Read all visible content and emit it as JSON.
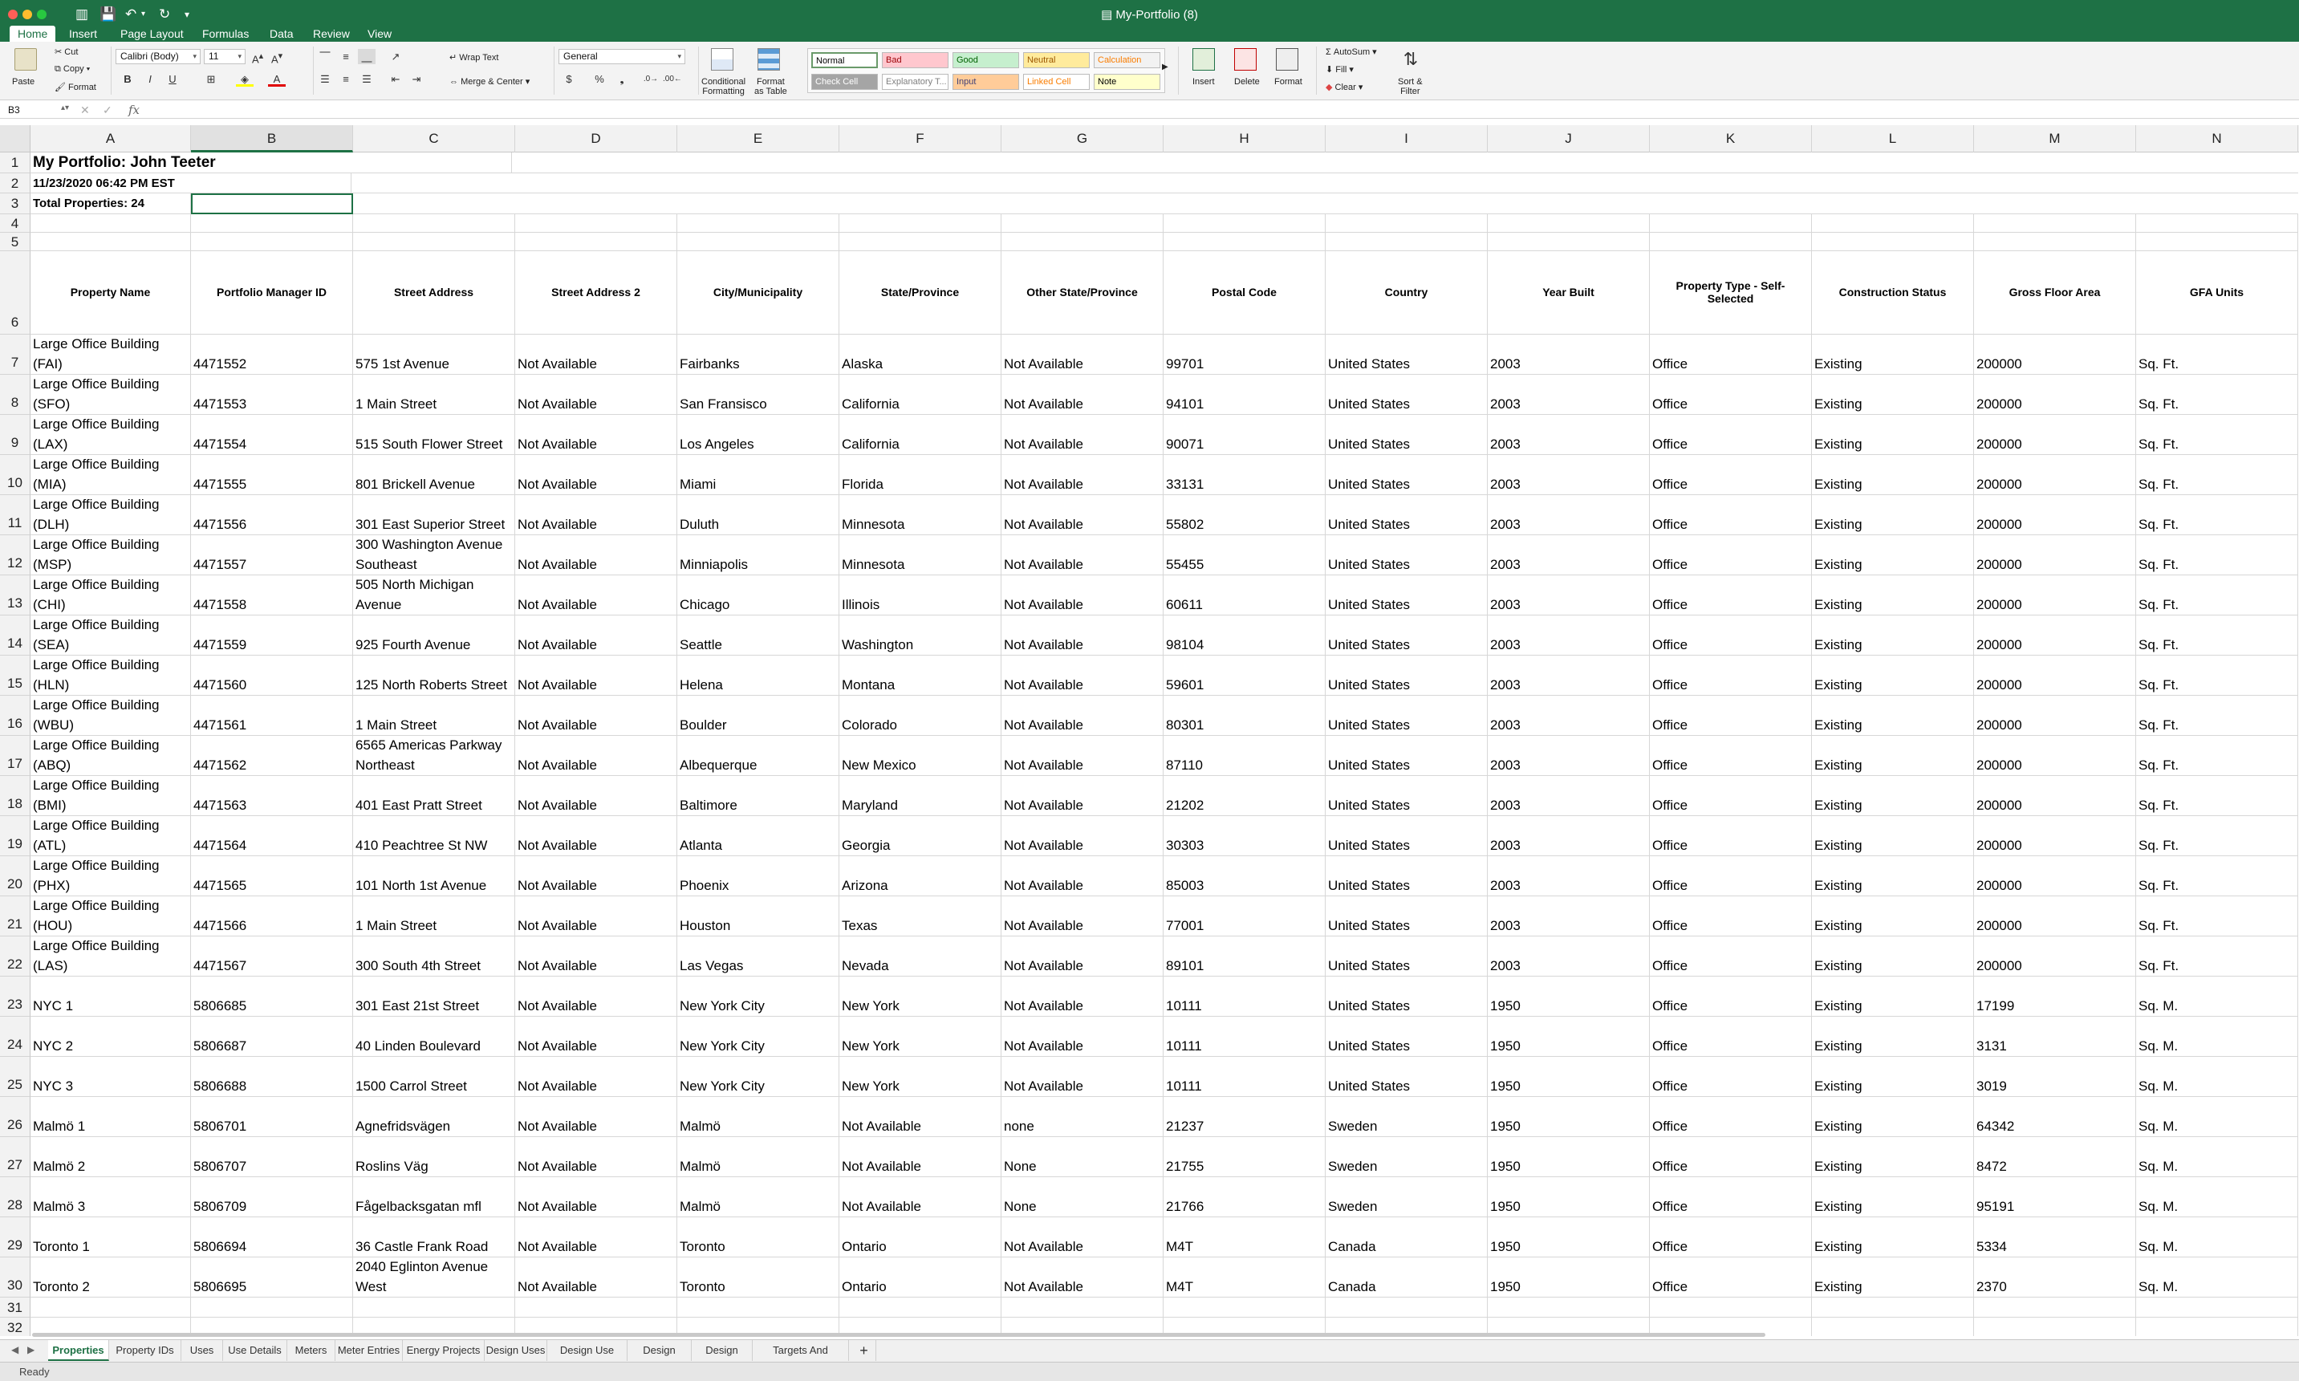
{
  "window": {
    "title": "My-Portfolio (8)"
  },
  "ribbon_tabs": [
    "Home",
    "Insert",
    "Page Layout",
    "Formulas",
    "Data",
    "Review",
    "View"
  ],
  "ribbon": {
    "paste": "Paste",
    "cut": "Cut",
    "copy": "Copy",
    "format_painter": "Format",
    "font_name": "Calibri (Body)",
    "font_size": "11",
    "wrap_text": "Wrap Text",
    "merge_center": "Merge & Center",
    "number_format": "General",
    "conditional_formatting": "Conditional\nFormatting",
    "format_as_table": "Format\nas Table",
    "styles": [
      {
        "label": "Normal",
        "bg": "#ffffff",
        "fg": "#000000"
      },
      {
        "label": "Bad",
        "bg": "#ffc7ce",
        "fg": "#9c0006"
      },
      {
        "label": "Good",
        "bg": "#c6efce",
        "fg": "#006100"
      },
      {
        "label": "Neutral",
        "bg": "#ffeb9c",
        "fg": "#9c5700"
      },
      {
        "label": "Calculation",
        "bg": "#f2f2f2",
        "fg": "#fa7d00"
      },
      {
        "label": "Check Cell",
        "bg": "#a5a5a5",
        "fg": "#ffffff"
      },
      {
        "label": "Explanatory T...",
        "bg": "#ffffff",
        "fg": "#7f7f7f"
      },
      {
        "label": "Input",
        "bg": "#ffcc99",
        "fg": "#3f3f76"
      },
      {
        "label": "Linked Cell",
        "bg": "#ffffff",
        "fg": "#fa7d00"
      },
      {
        "label": "Note",
        "bg": "#ffffcc",
        "fg": "#000000"
      }
    ],
    "insert": "Insert",
    "delete": "Delete",
    "format": "Format",
    "autosum": "AutoSum",
    "fill": "Fill",
    "clear": "Clear",
    "sort_filter": "Sort &\nFilter"
  },
  "formula_bar": {
    "name_box": "B3",
    "fx": "fx",
    "value": ""
  },
  "colors": {
    "brand": "#1e7145",
    "grid_line": "#d7d7d7",
    "selection": "#1e7145"
  },
  "columns": [
    "A",
    "B",
    "C",
    "D",
    "E",
    "F",
    "G",
    "H",
    "I",
    "J",
    "K",
    "L",
    "M",
    "N"
  ],
  "selected_column": "B",
  "selected_cell": "B3",
  "row_numbers": [
    "1",
    "2",
    "3",
    "4",
    "5",
    "6",
    "7",
    "8",
    "9",
    "10",
    "11",
    "12",
    "13",
    "14",
    "15",
    "16",
    "17",
    "18",
    "19",
    "20",
    "21",
    "22",
    "23",
    "24",
    "25",
    "26",
    "27",
    "28",
    "29",
    "30",
    "31",
    "32"
  ],
  "sheet": {
    "title": "My Portfolio: John Teeter",
    "timestamp": "11/23/2020 06:42 PM EST",
    "total": "Total Properties: 24",
    "headers": [
      "Property Name",
      "Portfolio Manager ID",
      "Street Address",
      "Street Address 2",
      "City/Municipality",
      "State/Province",
      "Other State/Province",
      "Postal Code",
      "Country",
      "Year Built",
      "Property Type - Self-Selected",
      "Construction Status",
      "Gross Floor Area",
      "GFA Units"
    ],
    "rows": [
      [
        "Large Office Building (FAI)",
        "4471552",
        "575 1st Avenue",
        "Not Available",
        "Fairbanks",
        "Alaska",
        "Not Available",
        "99701",
        "United States",
        "2003",
        "Office",
        "Existing",
        "200000",
        "Sq. Ft."
      ],
      [
        "Large Office Building (SFO)",
        "4471553",
        "1 Main Street",
        "Not Available",
        "San Fransisco",
        "California",
        "Not Available",
        "94101",
        "United States",
        "2003",
        "Office",
        "Existing",
        "200000",
        "Sq. Ft."
      ],
      [
        "Large Office Building (LAX)",
        "4471554",
        "515 South Flower Street",
        "Not Available",
        "Los Angeles",
        "California",
        "Not Available",
        "90071",
        "United States",
        "2003",
        "Office",
        "Existing",
        "200000",
        "Sq. Ft."
      ],
      [
        "Large Office Building (MIA)",
        "4471555",
        "801 Brickell Avenue",
        "Not Available",
        "Miami",
        "Florida",
        "Not Available",
        "33131",
        "United States",
        "2003",
        "Office",
        "Existing",
        "200000",
        "Sq. Ft."
      ],
      [
        "Large Office Building (DLH)",
        "4471556",
        "301 East Superior Street",
        "Not Available",
        "Duluth",
        "Minnesota",
        "Not Available",
        "55802",
        "United States",
        "2003",
        "Office",
        "Existing",
        "200000",
        "Sq. Ft."
      ],
      [
        "Large Office Building (MSP)",
        "4471557",
        "300 Washington Avenue Southeast",
        "Not Available",
        "Minniapolis",
        "Minnesota",
        "Not Available",
        "55455",
        "United States",
        "2003",
        "Office",
        "Existing",
        "200000",
        "Sq. Ft."
      ],
      [
        "Large Office Building (CHI)",
        "4471558",
        "505 North Michigan Avenue",
        "Not Available",
        "Chicago",
        "Illinois",
        "Not Available",
        "60611",
        "United States",
        "2003",
        "Office",
        "Existing",
        "200000",
        "Sq. Ft."
      ],
      [
        "Large Office Building (SEA)",
        "4471559",
        "925 Fourth Avenue",
        "Not Available",
        "Seattle",
        "Washington",
        "Not Available",
        "98104",
        "United States",
        "2003",
        "Office",
        "Existing",
        "200000",
        "Sq. Ft."
      ],
      [
        "Large Office Building (HLN)",
        "4471560",
        "125 North Roberts Street",
        "Not Available",
        "Helena",
        "Montana",
        "Not Available",
        "59601",
        "United States",
        "2003",
        "Office",
        "Existing",
        "200000",
        "Sq. Ft."
      ],
      [
        "Large Office Building (WBU)",
        "4471561",
        "1 Main Street",
        "Not Available",
        "Boulder",
        "Colorado",
        "Not Available",
        "80301",
        "United States",
        "2003",
        "Office",
        "Existing",
        "200000",
        "Sq. Ft."
      ],
      [
        "Large Office Building (ABQ)",
        "4471562",
        "6565 Americas Parkway Northeast",
        "Not Available",
        "Albequerque",
        "New Mexico",
        "Not Available",
        "87110",
        "United States",
        "2003",
        "Office",
        "Existing",
        "200000",
        "Sq. Ft."
      ],
      [
        "Large Office Building (BMI)",
        "4471563",
        "401 East Pratt Street",
        "Not Available",
        "Baltimore",
        "Maryland",
        "Not Available",
        "21202",
        "United States",
        "2003",
        "Office",
        "Existing",
        "200000",
        "Sq. Ft."
      ],
      [
        "Large Office Building (ATL)",
        "4471564",
        "410 Peachtree St NW",
        "Not Available",
        "Atlanta",
        "Georgia",
        "Not Available",
        "30303",
        "United States",
        "2003",
        "Office",
        "Existing",
        "200000",
        "Sq. Ft."
      ],
      [
        "Large Office Building (PHX)",
        "4471565",
        "101 North 1st Avenue",
        "Not Available",
        "Phoenix",
        "Arizona",
        "Not Available",
        "85003",
        "United States",
        "2003",
        "Office",
        "Existing",
        "200000",
        "Sq. Ft."
      ],
      [
        "Large Office Building (HOU)",
        "4471566",
        "1 Main Street",
        "Not Available",
        "Houston",
        "Texas",
        "Not Available",
        "77001",
        "United States",
        "2003",
        "Office",
        "Existing",
        "200000",
        "Sq. Ft."
      ],
      [
        "Large Office Building (LAS)",
        "4471567",
        "300 South 4th Street",
        "Not Available",
        "Las Vegas",
        "Nevada",
        "Not Available",
        "89101",
        "United States",
        "2003",
        "Office",
        "Existing",
        "200000",
        "Sq. Ft."
      ],
      [
        "NYC 1",
        "5806685",
        "301 East 21st Street",
        "Not Available",
        "New York City",
        "New York",
        "Not Available",
        "10111",
        "United States",
        "1950",
        "Office",
        "Existing",
        "17199",
        "Sq. M."
      ],
      [
        "NYC 2",
        "5806687",
        "40 Linden Boulevard",
        "Not Available",
        "New York City",
        "New York",
        "Not Available",
        "10111",
        "United States",
        "1950",
        "Office",
        "Existing",
        "3131",
        "Sq. M."
      ],
      [
        "NYC 3",
        "5806688",
        "1500 Carrol Street",
        "Not Available",
        "New York City",
        "New York",
        "Not Available",
        "10111",
        "United States",
        "1950",
        "Office",
        "Existing",
        "3019",
        "Sq. M."
      ],
      [
        "Malmö 1",
        "5806701",
        "Agnefridsvägen",
        "Not Available",
        "Malmö",
        "Not Available",
        "none",
        "21237",
        "Sweden",
        "1950",
        "Office",
        "Existing",
        "64342",
        "Sq. M."
      ],
      [
        "Malmö 2",
        "5806707",
        "Roslins Väg",
        "Not Available",
        "Malmö",
        "Not Available",
        "None",
        "21755",
        "Sweden",
        "1950",
        "Office",
        "Existing",
        "8472",
        "Sq. M."
      ],
      [
        "Malmö 3",
        "5806709",
        "Fågelbacksgatan mfl",
        "Not Available",
        "Malmö",
        "Not Available",
        "None",
        "21766",
        "Sweden",
        "1950",
        "Office",
        "Existing",
        "95191",
        "Sq. M."
      ],
      [
        "Toronto 1",
        "5806694",
        "36 Castle Frank Road",
        "Not Available",
        "Toronto",
        "Ontario",
        "Not Available",
        "M4T",
        "Canada",
        "1950",
        "Office",
        "Existing",
        "5334",
        "Sq. M."
      ],
      [
        "Toronto 2",
        "5806695",
        "2040 Eglinton Avenue West",
        "Not Available",
        "Toronto",
        "Ontario",
        "Not Available",
        "M4T",
        "Canada",
        "1950",
        "Office",
        "Existing",
        "2370",
        "Sq. M."
      ]
    ]
  },
  "sheet_tabs": [
    "Properties",
    "Property IDs",
    "Uses",
    "Use Details",
    "Meters",
    "Meter Entries",
    "Energy Projects",
    "Design Uses",
    "Design Use Details",
    "Design Energy",
    "Design Targets",
    "Targets And Baselines"
  ],
  "active_sheet": "Properties",
  "add_sheet": "+",
  "status": {
    "text": "Ready"
  }
}
